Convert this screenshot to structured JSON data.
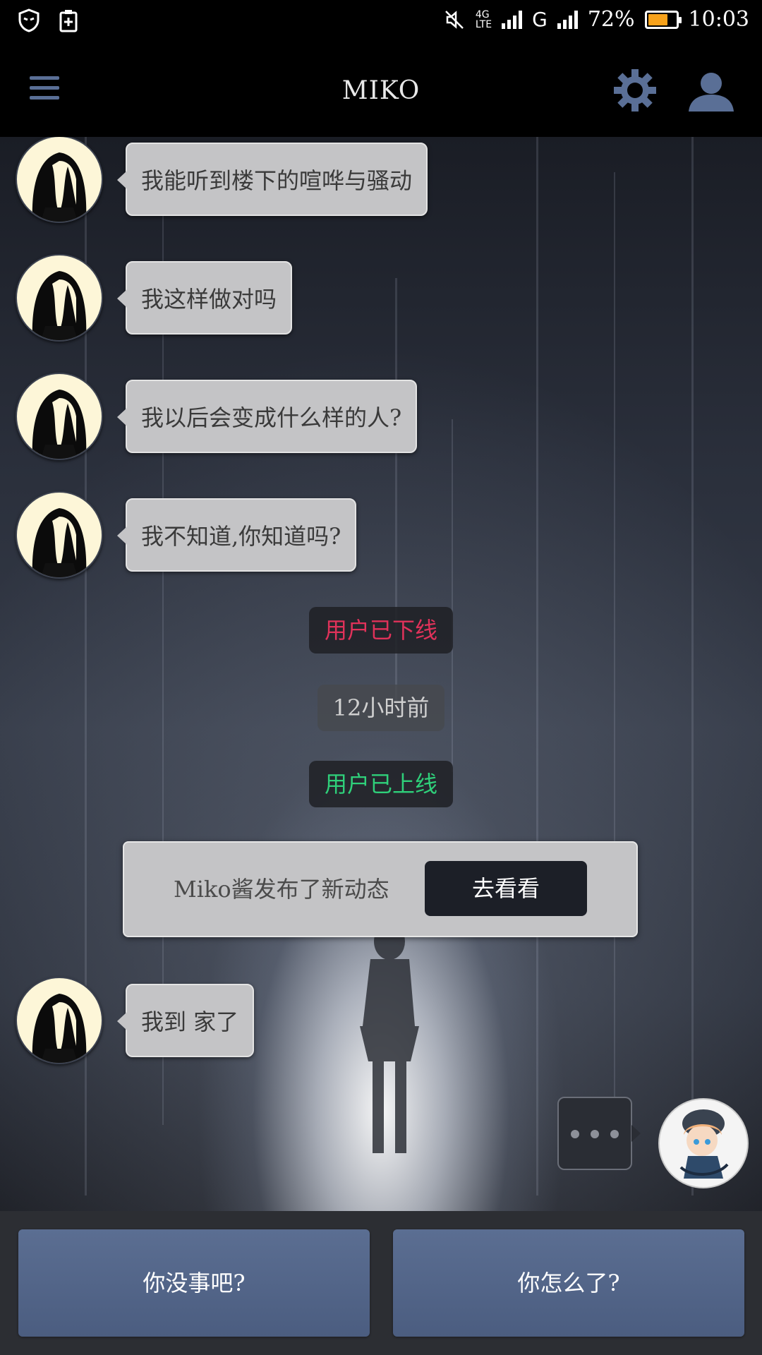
{
  "statusbar": {
    "network_label": "4G",
    "network_sub": "LTE",
    "network2_label": "G",
    "battery_percent_text": "72%",
    "battery_level": 0.72,
    "time": "10:03"
  },
  "header": {
    "title": "MIKO"
  },
  "messages": [
    {
      "text": "我能听到楼下的喧哗与骚动"
    },
    {
      "text": "我这样做对吗"
    },
    {
      "text": "我以后会变成什么样的人?"
    },
    {
      "text": "我不知道,你知道吗?"
    },
    {
      "text": "我到 家了"
    }
  ],
  "system": {
    "offline": "用户已下线",
    "offline_color": "#e0325a",
    "time_ago": "12小时前",
    "time_color": "#d0d0d0",
    "online": "用户已上线",
    "online_color": "#2fd07a"
  },
  "notice": {
    "text": "Miko酱发布了新动态",
    "button": "去看看"
  },
  "replies": [
    {
      "label": "你没事吧?"
    },
    {
      "label": "你怎么了?"
    }
  ]
}
